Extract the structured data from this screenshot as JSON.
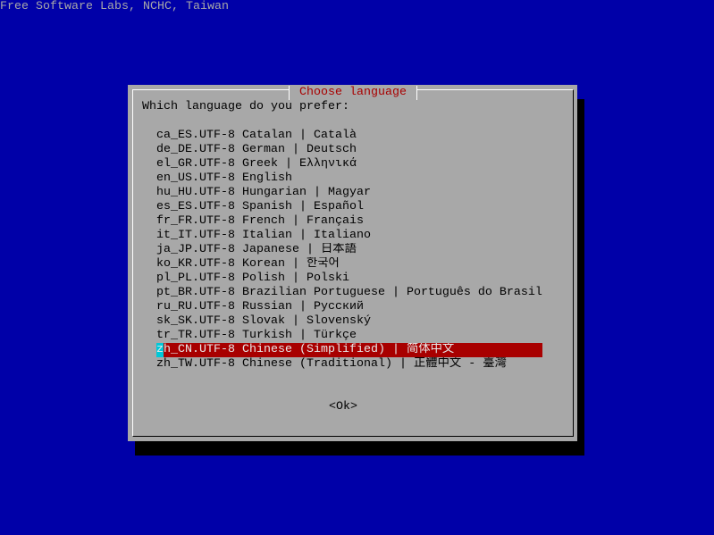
{
  "banner": "Free Software Labs, NCHC, Taiwan",
  "dialog": {
    "title": "Choose language",
    "prompt": "Which language do you prefer:",
    "selected_index": 15,
    "items": [
      {
        "tag": "ca_ES.UTF-8",
        "description": "Catalan | Català"
      },
      {
        "tag": "de_DE.UTF-8",
        "description": "German | Deutsch"
      },
      {
        "tag": "el_GR.UTF-8",
        "description": "Greek | Ελληνικά"
      },
      {
        "tag": "en_US.UTF-8",
        "description": "English"
      },
      {
        "tag": "hu_HU.UTF-8",
        "description": "Hungarian | Magyar"
      },
      {
        "tag": "es_ES.UTF-8",
        "description": "Spanish | Español"
      },
      {
        "tag": "fr_FR.UTF-8",
        "description": "French | Français"
      },
      {
        "tag": "it_IT.UTF-8",
        "description": "Italian | Italiano"
      },
      {
        "tag": "ja_JP.UTF-8",
        "description": "Japanese | 日本語"
      },
      {
        "tag": "ko_KR.UTF-8",
        "description": "Korean | 한국어"
      },
      {
        "tag": "pl_PL.UTF-8",
        "description": "Polish | Polski"
      },
      {
        "tag": "pt_BR.UTF-8",
        "description": "Brazilian Portuguese | Português do Brasil"
      },
      {
        "tag": "ru_RU.UTF-8",
        "description": "Russian | Русский"
      },
      {
        "tag": "sk_SK.UTF-8",
        "description": "Slovak | Slovenský"
      },
      {
        "tag": "tr_TR.UTF-8",
        "description": "Turkish | Türkçe"
      },
      {
        "tag": "zh_CN.UTF-8",
        "description": "Chinese (Simplified) | 简体中文"
      },
      {
        "tag": "zh_TW.UTF-8",
        "description": "Chinese (Traditional) | 正體中文 - 臺灣"
      }
    ],
    "ok_button": "<Ok>"
  },
  "colors": {
    "screen_background": "#0000a8",
    "dialog_background": "#a8a8a8",
    "shadow": "#000000",
    "text": "#000000",
    "banner_text": "#a8a8a8",
    "title_text": "#a80000",
    "selected_background": "#a80000",
    "selected_text": "#e8e8e8",
    "cursor": "#00c8d8"
  }
}
